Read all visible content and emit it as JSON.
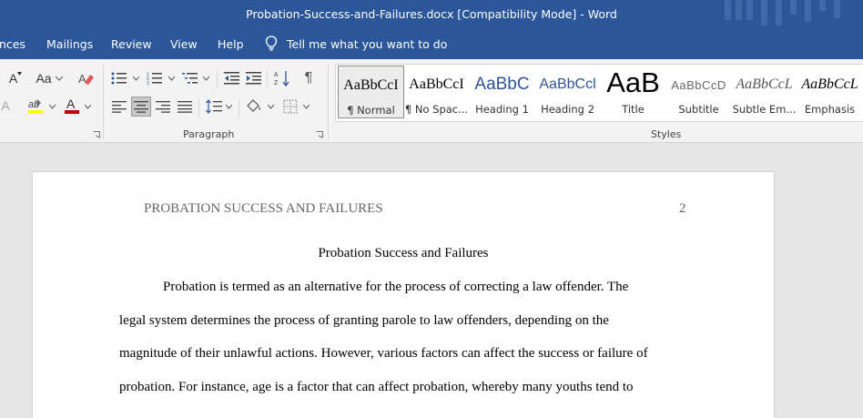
{
  "window": {
    "title": "Probation-Success-and-Failures.docx [Compatibility Mode]  -  Word"
  },
  "menu": {
    "items": [
      "nces",
      "Mailings",
      "Review",
      "View",
      "Help"
    ],
    "tell_me": "Tell me what you want to do"
  },
  "ribbon": {
    "font_size_buttons": {
      "shrink": "A",
      "change_case": "Aa"
    },
    "highlight_color": "#ffff00",
    "font_color": "#c00000",
    "paragraph_label": "Paragraph",
    "styles_label": "Styles",
    "styles": [
      {
        "preview": "AaBbCcI",
        "name": "¶ Normal",
        "selected": true
      },
      {
        "preview": "AaBbCcI",
        "name": "¶ No Spac..."
      },
      {
        "preview": "AaBbC",
        "name": "Heading 1"
      },
      {
        "preview": "AaBbCcl",
        "name": "Heading 2"
      },
      {
        "preview": "AaB",
        "name": "Title"
      },
      {
        "preview": "AaBbCcD",
        "name": "Subtitle"
      },
      {
        "preview": "AaBbCcL",
        "name": "Subtle Em..."
      },
      {
        "preview": "AaBbCcL",
        "name": "Emphasis"
      }
    ]
  },
  "document": {
    "header_title": "PROBATION SUCCESS AND FAILURES",
    "page_number": "2",
    "title": "Probation Success and Failures",
    "lines": [
      "Probation is termed as an alternative for the process of correcting a law offender. The",
      "legal system determines the process of granting parole to law offenders, depending on the",
      "magnitude of their unlawful actions. However, various factors can affect the success or failure of",
      "probation. For instance, age is a factor that can affect probation, whereby many youths tend to"
    ]
  },
  "colors": {
    "accent": "#2b579a",
    "page_bg": "#e6e6e6"
  }
}
